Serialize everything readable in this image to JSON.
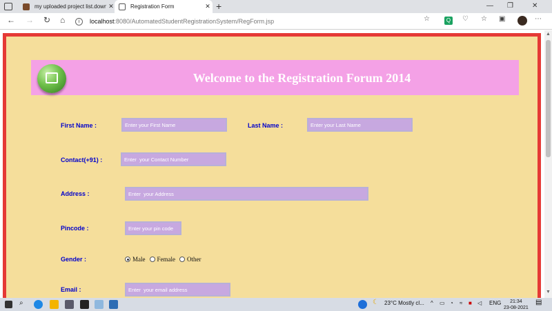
{
  "browser": {
    "tabs": [
      {
        "title": "my uploaded project list.downlo",
        "active": false
      },
      {
        "title": "Registration Form",
        "active": true
      }
    ],
    "close_glyph": "✕",
    "new_tab_glyph": "+",
    "url_host": "localhost",
    "url_path": ":8080/AutomatedStudentRegistrationSystem/RegForm.jsp",
    "icons": [
      "back-icon",
      "forward-icon",
      "reload-icon",
      "home-icon",
      "info-icon",
      "favorites-add-icon",
      "extension-icon",
      "favorites-icon",
      "collections-icon",
      "profile-icon",
      "menu-icon"
    ]
  },
  "page": {
    "banner_title": "Welcome to the Registration Forum 2014",
    "fields": {
      "first_name": {
        "label": "First Name :",
        "placeholder": "Enter your First Name"
      },
      "last_name": {
        "label": "Last Name :",
        "placeholder": "Enter your Last Name"
      },
      "contact": {
        "label": "Contact(+91) :",
        "placeholder": "Enter  your Contact Number"
      },
      "address": {
        "label": "Address :",
        "placeholder": "Enter  your Address"
      },
      "pincode": {
        "label": "Pincode :",
        "placeholder": "Enter your pin code"
      },
      "gender": {
        "label": "Gender :",
        "options": [
          "Male",
          "Female",
          "Other"
        ],
        "selected": "Male"
      },
      "email": {
        "label": "Email :",
        "placeholder": "Enter  your email address"
      }
    },
    "colors": {
      "background": "#f5de9b",
      "border": "#e53935",
      "banner": "#f4a1e6",
      "label": "#0000cc",
      "input": "#c7a8e0"
    }
  },
  "taskbar": {
    "weather": "23°C  Mostly cl...",
    "language": "ENG",
    "time": "21:34",
    "date": "23-08-2021"
  }
}
